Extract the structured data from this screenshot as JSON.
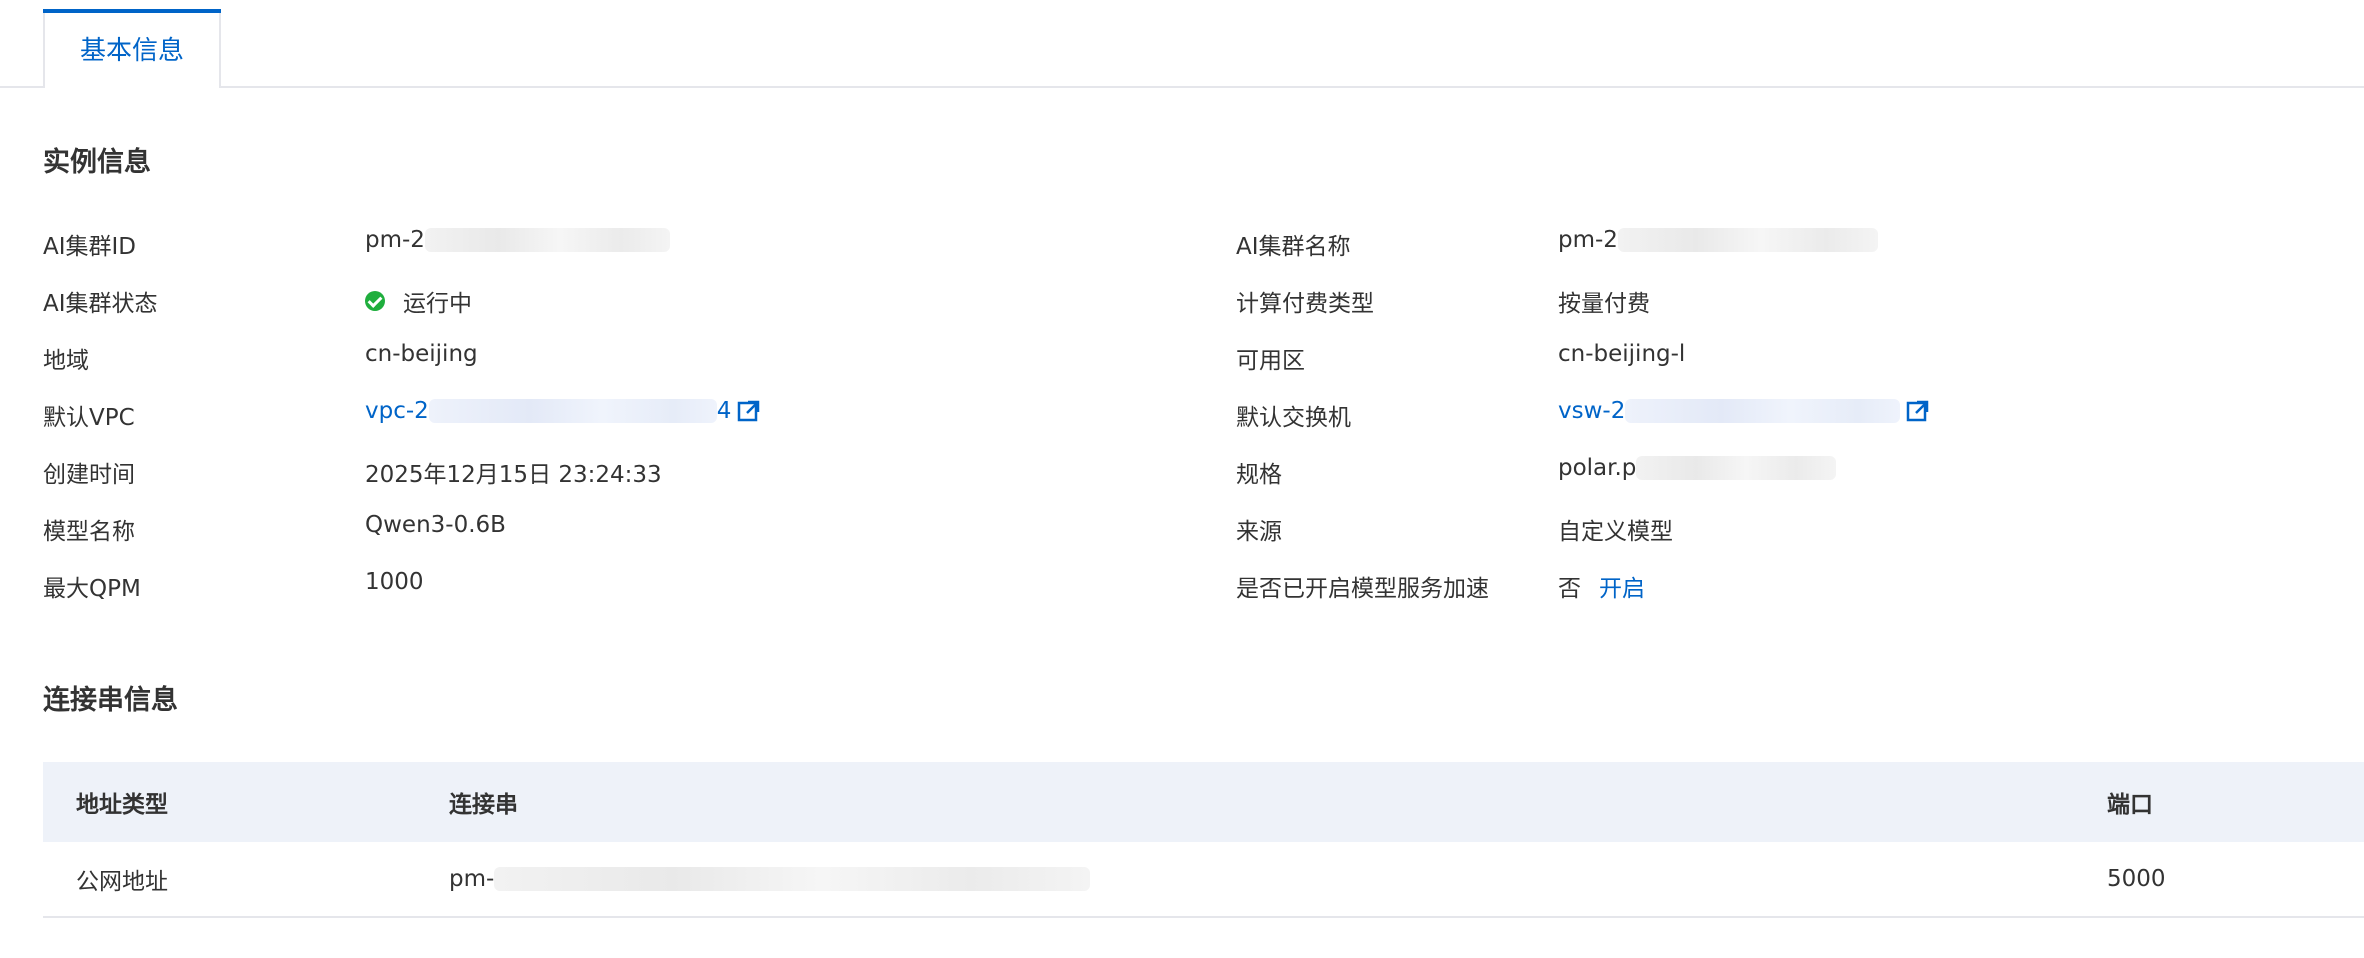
{
  "tabs": [
    {
      "label": "基本信息",
      "active": true
    }
  ],
  "sections": {
    "instance_title": "实例信息",
    "connection_title": "连接串信息"
  },
  "instance": {
    "cluster_id": {
      "label": "AI集群ID",
      "value": "pm-2"
    },
    "cluster_name": {
      "label": "AI集群名称",
      "value": "pm-2"
    },
    "cluster_status": {
      "label": "AI集群状态",
      "value": "运行中"
    },
    "billing_type": {
      "label": "计算付费类型",
      "value": "按量付费"
    },
    "region": {
      "label": "地域",
      "value": "cn-beijing"
    },
    "zone": {
      "label": "可用区",
      "value": "cn-beijing-l"
    },
    "vpc": {
      "label": "默认VPC",
      "value_prefix": "vpc-2",
      "value_suffix": "4"
    },
    "vswitch": {
      "label": "默认交换机",
      "value": "vsw-2"
    },
    "create_time": {
      "label": "创建时间",
      "value": "2025年12月15日 23:24:33"
    },
    "spec": {
      "label": "规格",
      "value": "polar.p"
    },
    "model_name": {
      "label": "模型名称",
      "value": "Qwen3-0.6B"
    },
    "source": {
      "label": "来源",
      "value": "自定义模型"
    },
    "max_qpm": {
      "label": "最大QPM",
      "value": "1000"
    },
    "acceleration": {
      "label": "是否已开启模型服务加速",
      "value": "否",
      "action": "开启"
    }
  },
  "connection_table": {
    "columns": [
      "地址类型",
      "连接串",
      "端口"
    ],
    "rows": [
      {
        "type": "公网地址",
        "conn": "pm-",
        "port": "5000"
      }
    ]
  },
  "colors": {
    "accent": "#0064c8",
    "status_running": "#1fae3d",
    "table_header_bg": "#eef2f9",
    "border": "#e5e6eb"
  },
  "icons": [
    "external-link-icon",
    "status-running-icon"
  ]
}
